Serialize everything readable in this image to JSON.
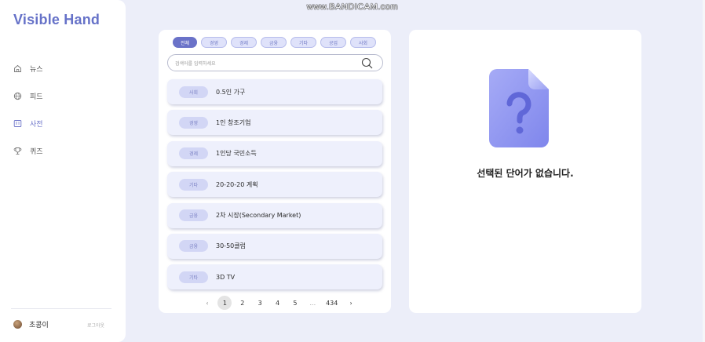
{
  "watermark": "www.BANDICAM.com",
  "app": {
    "title": "Visible Hand"
  },
  "sidebar": {
    "items": [
      {
        "label": "뉴스",
        "icon": "home-icon"
      },
      {
        "label": "피드",
        "icon": "globe-icon"
      },
      {
        "label": "사전",
        "icon": "dictionary-icon",
        "active": true
      },
      {
        "label": "퀴즈",
        "icon": "trophy-icon"
      }
    ],
    "user": {
      "name": "초콩이",
      "logout": "로그아웃"
    }
  },
  "filters": [
    "전체",
    "경영",
    "경제",
    "금융",
    "기타",
    "공업",
    "사회"
  ],
  "search": {
    "placeholder": "검색어를 입력하세요"
  },
  "words": [
    {
      "tag": "사회",
      "term": "0.5인 가구"
    },
    {
      "tag": "경영",
      "term": "1인 창조기업"
    },
    {
      "tag": "경제",
      "term": "1인당 국민소득"
    },
    {
      "tag": "기타",
      "term": "20-20-20 계획"
    },
    {
      "tag": "금융",
      "term": "2차 시장(Secondary Market)"
    },
    {
      "tag": "금융",
      "term": "30-50클럽"
    },
    {
      "tag": "기타",
      "term": "3D TV"
    }
  ],
  "pagination": {
    "prev": "‹",
    "pages": [
      "1",
      "2",
      "3",
      "4",
      "5"
    ],
    "ellipsis": "...",
    "last": "434",
    "next": "›",
    "current": 1
  },
  "detail": {
    "empty_message": "선택된 단어가 없습니다."
  },
  "colors": {
    "accent": "#6a72c8",
    "chip_bg": "#dfe2fa",
    "row_bg": "#eef0fc",
    "page_bg": "#eceef9"
  }
}
